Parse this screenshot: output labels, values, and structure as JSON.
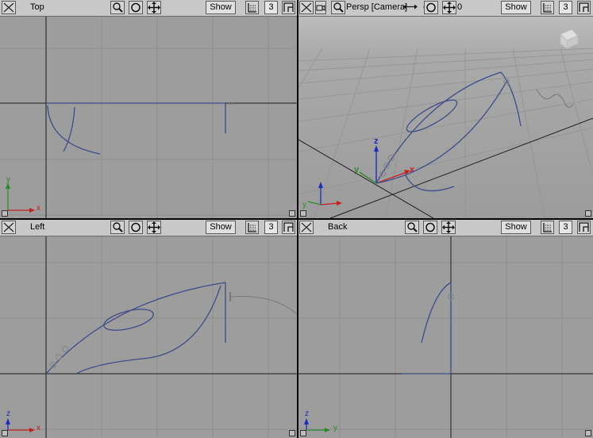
{
  "viewports": {
    "top": {
      "title": "Top",
      "show_label": "Show",
      "count": "3",
      "axis_v": "y",
      "axis_h": "x"
    },
    "persp": {
      "title": "Persp [Camera]",
      "show_label": "Show",
      "count": "3",
      "zoom_value": "0",
      "axis_v": "z",
      "axis_h": "x",
      "axis_g": "y"
    },
    "left": {
      "title": "Left",
      "show_label": "Show",
      "count": "3",
      "axis_v": "z",
      "axis_h": "x"
    },
    "back": {
      "title": "Back",
      "show_label": "Show",
      "count": "3",
      "axis_v": "z",
      "axis_h": "y"
    }
  }
}
